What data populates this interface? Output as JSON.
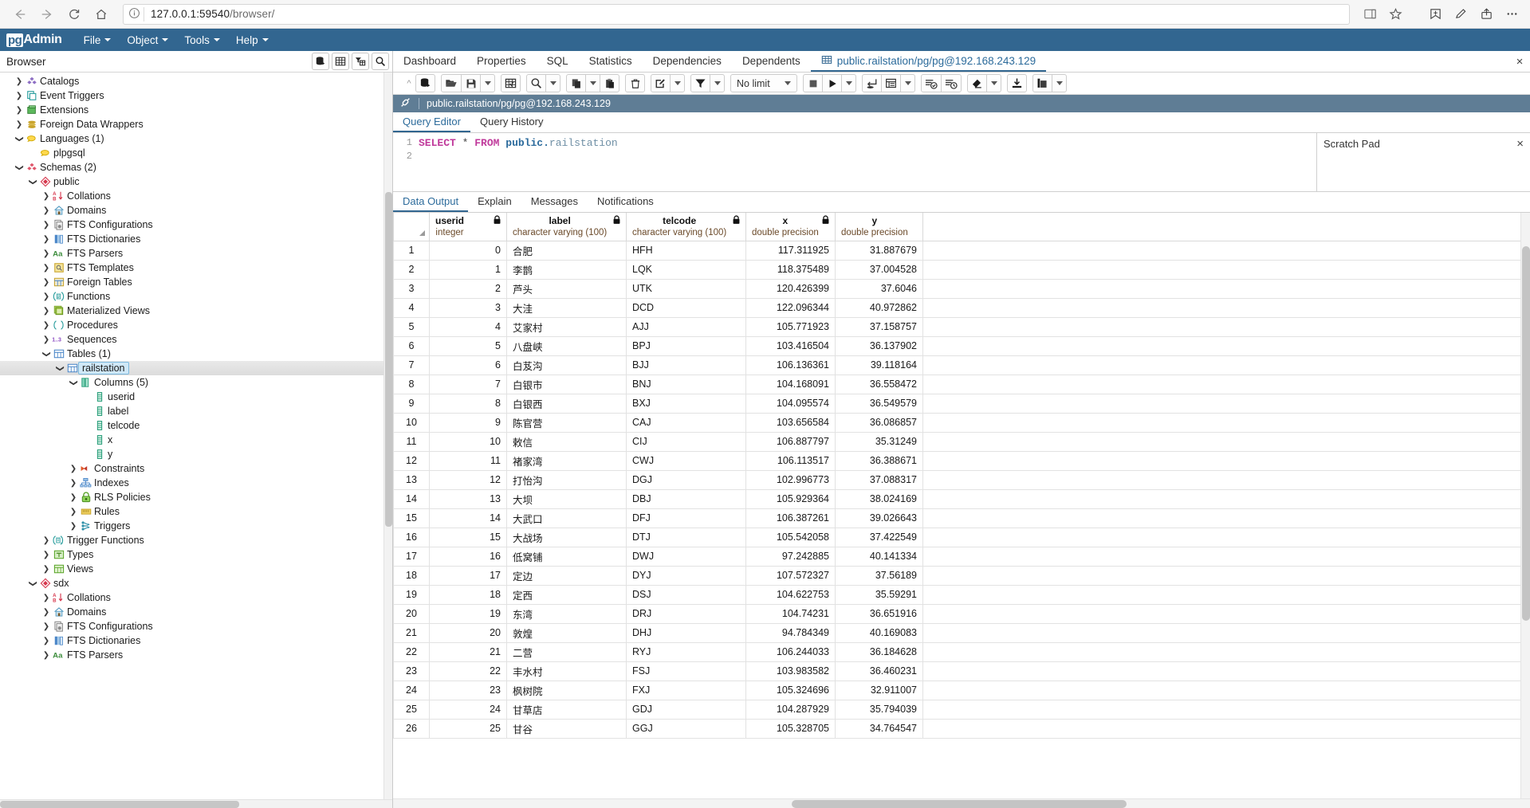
{
  "browser": {
    "url_host": "127.0.0.1:59540",
    "url_path": "/browser/",
    "back_icon": "back-arrow-icon",
    "forward_icon": "forward-arrow-icon",
    "reload_icon": "reload-icon",
    "home_icon": "home-icon",
    "info_icon": "info-circle-icon",
    "star_icon": "star-icon",
    "collections_icon": "collections-icon",
    "favorites_icon": "favorites-icon",
    "pen_icon": "pen-icon",
    "share_icon": "share-icon",
    "more_icon": "more-icon"
  },
  "navbar": {
    "logo_pg": "pg",
    "logo_admin": "Admin",
    "menus": [
      "File",
      "Object",
      "Tools",
      "Help"
    ]
  },
  "sidebar": {
    "title": "Browser",
    "tools": [
      "server-icon-button",
      "grid-icon-button",
      "filter-grid-icon-button",
      "search-icon-button"
    ],
    "tree": [
      {
        "label": "Catalogs",
        "indent": 1,
        "arrow": "collapsed",
        "icon": "catalogs"
      },
      {
        "label": "Event Triggers",
        "indent": 1,
        "arrow": "collapsed",
        "icon": "event-triggers"
      },
      {
        "label": "Extensions",
        "indent": 1,
        "arrow": "collapsed",
        "icon": "extensions"
      },
      {
        "label": "Foreign Data Wrappers",
        "indent": 1,
        "arrow": "collapsed",
        "icon": "fdw"
      },
      {
        "label": "Languages (1)",
        "indent": 1,
        "arrow": "expanded",
        "icon": "language"
      },
      {
        "label": "plpgsql",
        "indent": 2,
        "arrow": "none",
        "icon": "language"
      },
      {
        "label": "Schemas (2)",
        "indent": 1,
        "arrow": "expanded",
        "icon": "schemas"
      },
      {
        "label": "public",
        "indent": 2,
        "arrow": "expanded",
        "icon": "schema"
      },
      {
        "label": "Collations",
        "indent": 3,
        "arrow": "collapsed",
        "icon": "collations"
      },
      {
        "label": "Domains",
        "indent": 3,
        "arrow": "collapsed",
        "icon": "domains"
      },
      {
        "label": "FTS Configurations",
        "indent": 3,
        "arrow": "collapsed",
        "icon": "fts-config"
      },
      {
        "label": "FTS Dictionaries",
        "indent": 3,
        "arrow": "collapsed",
        "icon": "fts-dict"
      },
      {
        "label": "FTS Parsers",
        "indent": 3,
        "arrow": "collapsed",
        "icon": "fts-parser"
      },
      {
        "label": "FTS Templates",
        "indent": 3,
        "arrow": "collapsed",
        "icon": "fts-template"
      },
      {
        "label": "Foreign Tables",
        "indent": 3,
        "arrow": "collapsed",
        "icon": "foreign-tables"
      },
      {
        "label": "Functions",
        "indent": 3,
        "arrow": "collapsed",
        "icon": "functions"
      },
      {
        "label": "Materialized Views",
        "indent": 3,
        "arrow": "collapsed",
        "icon": "matviews"
      },
      {
        "label": "Procedures",
        "indent": 3,
        "arrow": "collapsed",
        "icon": "procedures"
      },
      {
        "label": "Sequences",
        "indent": 3,
        "arrow": "collapsed",
        "icon": "sequences"
      },
      {
        "label": "Tables (1)",
        "indent": 3,
        "arrow": "expanded",
        "icon": "tables"
      },
      {
        "label": "railstation",
        "indent": 4,
        "arrow": "expanded",
        "icon": "table",
        "selected": true
      },
      {
        "label": "Columns (5)",
        "indent": 5,
        "arrow": "expanded",
        "icon": "columns"
      },
      {
        "label": "userid",
        "indent": 6,
        "arrow": "none",
        "icon": "column"
      },
      {
        "label": "label",
        "indent": 6,
        "arrow": "none",
        "icon": "column"
      },
      {
        "label": "telcode",
        "indent": 6,
        "arrow": "none",
        "icon": "column"
      },
      {
        "label": "x",
        "indent": 6,
        "arrow": "none",
        "icon": "column"
      },
      {
        "label": "y",
        "indent": 6,
        "arrow": "none",
        "icon": "column"
      },
      {
        "label": "Constraints",
        "indent": 5,
        "arrow": "collapsed",
        "icon": "constraints"
      },
      {
        "label": "Indexes",
        "indent": 5,
        "arrow": "collapsed",
        "icon": "indexes"
      },
      {
        "label": "RLS Policies",
        "indent": 5,
        "arrow": "collapsed",
        "icon": "rls"
      },
      {
        "label": "Rules",
        "indent": 5,
        "arrow": "collapsed",
        "icon": "rules"
      },
      {
        "label": "Triggers",
        "indent": 5,
        "arrow": "collapsed",
        "icon": "triggers"
      },
      {
        "label": "Trigger Functions",
        "indent": 3,
        "arrow": "collapsed",
        "icon": "trigger-functions"
      },
      {
        "label": "Types",
        "indent": 3,
        "arrow": "collapsed",
        "icon": "types"
      },
      {
        "label": "Views",
        "indent": 3,
        "arrow": "collapsed",
        "icon": "views"
      },
      {
        "label": "sdx",
        "indent": 2,
        "arrow": "expanded",
        "icon": "schema"
      },
      {
        "label": "Collations",
        "indent": 3,
        "arrow": "collapsed",
        "icon": "collations"
      },
      {
        "label": "Domains",
        "indent": 3,
        "arrow": "collapsed",
        "icon": "domains"
      },
      {
        "label": "FTS Configurations",
        "indent": 3,
        "arrow": "collapsed",
        "icon": "fts-config"
      },
      {
        "label": "FTS Dictionaries",
        "indent": 3,
        "arrow": "collapsed",
        "icon": "fts-dict"
      },
      {
        "label": "FTS Parsers",
        "indent": 3,
        "arrow": "collapsed",
        "icon": "fts-parser"
      }
    ]
  },
  "panel_tabs": {
    "items": [
      "Dashboard",
      "Properties",
      "SQL",
      "Statistics",
      "Dependencies",
      "Dependents"
    ],
    "active_tab": "public.railstation/pg/pg@192.168.243.129",
    "close_label": "×"
  },
  "query_toolbar": {
    "groups": [
      [
        "open-file-panel-icon"
      ],
      [
        "open-file-icon",
        "save-file-icon",
        "save-caret"
      ],
      [
        "find-replace-grid-icon"
      ],
      [
        "search-icon",
        "search-caret"
      ],
      [
        "copy-icon",
        "copy-caret",
        "paste-icon"
      ],
      [
        "delete-icon"
      ],
      [
        "edit-icon",
        "edit-caret"
      ],
      [
        "filter-icon",
        "filter-caret"
      ],
      [
        "row-limit-select"
      ],
      [
        "stop-icon",
        "execute-icon",
        "execute-caret"
      ],
      [
        "explain-icon",
        "explain-options-icon",
        "explain-caret"
      ],
      [
        "commit-icon",
        "rollback-icon"
      ],
      [
        "clear-icon",
        "clear-caret"
      ],
      [
        "download-icon"
      ],
      [
        "macros-icon",
        "macros-caret"
      ]
    ],
    "row_limit_value": "No limit"
  },
  "session": {
    "icon": "connection-icon",
    "title": "public.railstation/pg/pg@192.168.243.129"
  },
  "editor_tabs": {
    "items": [
      "Query Editor",
      "Query History"
    ],
    "active": "Query Editor"
  },
  "editor": {
    "line_numbers": [
      "1",
      "2"
    ],
    "sql_keyword1": "SELECT",
    "sql_star": "*",
    "sql_keyword2": "FROM",
    "sql_schema": "public.",
    "sql_table": "railstation"
  },
  "scratch_pad": {
    "title": "Scratch Pad",
    "close_label": "×"
  },
  "output_tabs": {
    "items": [
      "Data Output",
      "Explain",
      "Messages",
      "Notifications"
    ],
    "active": "Data Output"
  },
  "grid": {
    "columns": [
      {
        "name": "",
        "type": "",
        "key": "rn"
      },
      {
        "name": "userid",
        "type": "integer",
        "locked": true
      },
      {
        "name": "label",
        "type": "character varying (100)",
        "locked": true
      },
      {
        "name": "telcode",
        "type": "character varying (100)",
        "locked": true
      },
      {
        "name": "x",
        "type": "double precision",
        "locked": true
      },
      {
        "name": "y",
        "type": "double precision",
        "locked": false
      }
    ],
    "rows": [
      {
        "rn": "1",
        "userid": "0",
        "label": "合肥",
        "telcode": "HFH",
        "x": "117.311925",
        "y": "31.887679"
      },
      {
        "rn": "2",
        "userid": "1",
        "label": "李鹊",
        "telcode": "LQK",
        "x": "118.375489",
        "y": "37.004528"
      },
      {
        "rn": "3",
        "userid": "2",
        "label": "芦头",
        "telcode": "UTK",
        "x": "120.426399",
        "y": "37.6046"
      },
      {
        "rn": "4",
        "userid": "3",
        "label": "大洼",
        "telcode": "DCD",
        "x": "122.096344",
        "y": "40.972862"
      },
      {
        "rn": "5",
        "userid": "4",
        "label": "艾家村",
        "telcode": "AJJ",
        "x": "105.771923",
        "y": "37.158757"
      },
      {
        "rn": "6",
        "userid": "5",
        "label": "八盘峡",
        "telcode": "BPJ",
        "x": "103.416504",
        "y": "36.137902"
      },
      {
        "rn": "7",
        "userid": "6",
        "label": "白芨沟",
        "telcode": "BJJ",
        "x": "106.136361",
        "y": "39.118164"
      },
      {
        "rn": "8",
        "userid": "7",
        "label": "白银市",
        "telcode": "BNJ",
        "x": "104.168091",
        "y": "36.558472"
      },
      {
        "rn": "9",
        "userid": "8",
        "label": "白银西",
        "telcode": "BXJ",
        "x": "104.095574",
        "y": "36.549579"
      },
      {
        "rn": "10",
        "userid": "9",
        "label": "陈官营",
        "telcode": "CAJ",
        "x": "103.656584",
        "y": "36.086857"
      },
      {
        "rn": "11",
        "userid": "10",
        "label": "敕信",
        "telcode": "CIJ",
        "x": "106.887797",
        "y": "35.31249"
      },
      {
        "rn": "12",
        "userid": "11",
        "label": "褚家湾",
        "telcode": "CWJ",
        "x": "106.113517",
        "y": "36.388671"
      },
      {
        "rn": "13",
        "userid": "12",
        "label": "打怡沟",
        "telcode": "DGJ",
        "x": "102.996773",
        "y": "37.088317"
      },
      {
        "rn": "14",
        "userid": "13",
        "label": "大坝",
        "telcode": "DBJ",
        "x": "105.929364",
        "y": "38.024169"
      },
      {
        "rn": "15",
        "userid": "14",
        "label": "大武口",
        "telcode": "DFJ",
        "x": "106.387261",
        "y": "39.026643"
      },
      {
        "rn": "16",
        "userid": "15",
        "label": "大战场",
        "telcode": "DTJ",
        "x": "105.542058",
        "y": "37.422549"
      },
      {
        "rn": "17",
        "userid": "16",
        "label": "低窝铺",
        "telcode": "DWJ",
        "x": "97.242885",
        "y": "40.141334"
      },
      {
        "rn": "18",
        "userid": "17",
        "label": "定边",
        "telcode": "DYJ",
        "x": "107.572327",
        "y": "37.56189"
      },
      {
        "rn": "19",
        "userid": "18",
        "label": "定西",
        "telcode": "DSJ",
        "x": "104.622753",
        "y": "35.59291"
      },
      {
        "rn": "20",
        "userid": "19",
        "label": "东湾",
        "telcode": "DRJ",
        "x": "104.74231",
        "y": "36.651916"
      },
      {
        "rn": "21",
        "userid": "20",
        "label": "敦煌",
        "telcode": "DHJ",
        "x": "94.784349",
        "y": "40.169083"
      },
      {
        "rn": "22",
        "userid": "21",
        "label": "二营",
        "telcode": "RYJ",
        "x": "106.244033",
        "y": "36.184628"
      },
      {
        "rn": "23",
        "userid": "22",
        "label": "丰水村",
        "telcode": "FSJ",
        "x": "103.983582",
        "y": "36.460231"
      },
      {
        "rn": "24",
        "userid": "23",
        "label": "枫树院",
        "telcode": "FXJ",
        "x": "105.324696",
        "y": "32.911007"
      },
      {
        "rn": "25",
        "userid": "24",
        "label": "甘草店",
        "telcode": "GDJ",
        "x": "104.287929",
        "y": "35.794039"
      },
      {
        "rn": "26",
        "userid": "25",
        "label": "甘谷",
        "telcode": "GGJ",
        "x": "105.328705",
        "y": "34.764547"
      }
    ]
  },
  "colors": {
    "brand": "#326690",
    "accent": "#2c6b9b",
    "session_bar": "#5f7d95",
    "keyword": "#c0399b",
    "schema": "#2b6a9c"
  }
}
